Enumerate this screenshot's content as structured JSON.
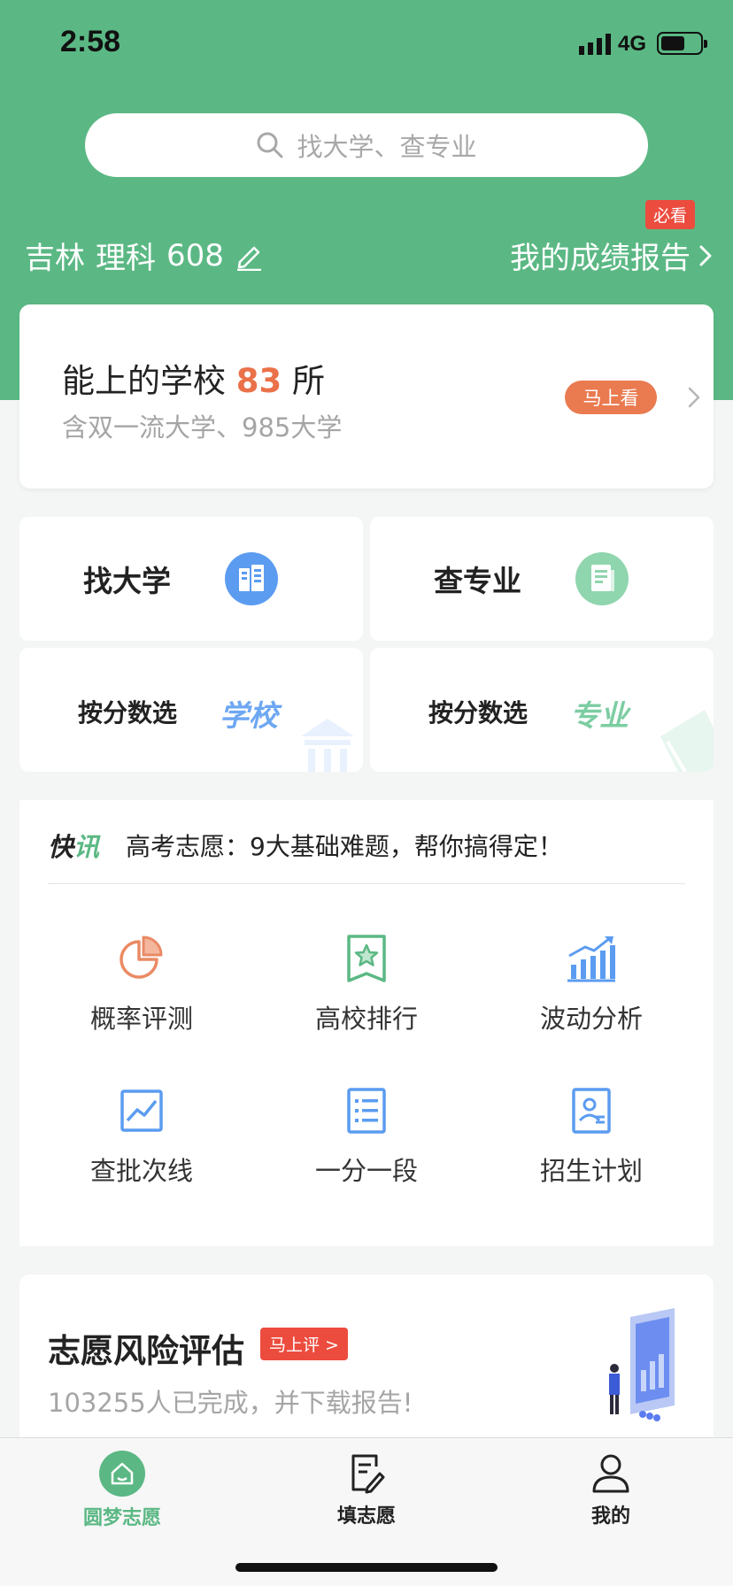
{
  "status_bar": {
    "time": "2:58",
    "network": "4G"
  },
  "search": {
    "placeholder": "找大学、查专业"
  },
  "score": {
    "province": "吉林",
    "subject": "理科",
    "score": "608"
  },
  "report": {
    "label": "我的成绩报告",
    "badge": "必看"
  },
  "main_card": {
    "title_prefix": "能上的学校",
    "count": "83",
    "title_suffix": "所",
    "subtitle": "含双一流大学、985大学",
    "button": "马上看"
  },
  "tiles": {
    "find_university": "找大学",
    "find_major": "查专业",
    "by_score_label": "按分数选",
    "by_score_school": "学校",
    "by_score_major": "专业"
  },
  "news": {
    "tag_a": "快",
    "tag_b": "讯",
    "text": "高考志愿：9大基础难题，帮你搞得定！"
  },
  "grid": [
    {
      "label": "概率评测",
      "icon": "pie-chart-icon"
    },
    {
      "label": "高校排行",
      "icon": "ranking-star-icon"
    },
    {
      "label": "波动分析",
      "icon": "trend-bars-icon"
    },
    {
      "label": "查批次线",
      "icon": "line-chart-icon"
    },
    {
      "label": "一分一段",
      "icon": "list-doc-icon"
    },
    {
      "label": "招生计划",
      "icon": "profile-doc-icon"
    }
  ],
  "risk": {
    "title": "志愿风险评估",
    "badge": "马上评 >",
    "subtitle": "103255人已完成，并下载报告!"
  },
  "tabbar": [
    {
      "label": "圆梦志愿",
      "icon": "home-icon",
      "active": true
    },
    {
      "label": "填志愿",
      "icon": "edit-doc-icon",
      "active": false
    },
    {
      "label": "我的",
      "icon": "user-icon",
      "active": false
    }
  ],
  "colors": {
    "brand_green": "#5bb884",
    "accent_orange": "#ea7149",
    "badge_red": "#ec4c3e",
    "blue": "#5b9cf1"
  }
}
